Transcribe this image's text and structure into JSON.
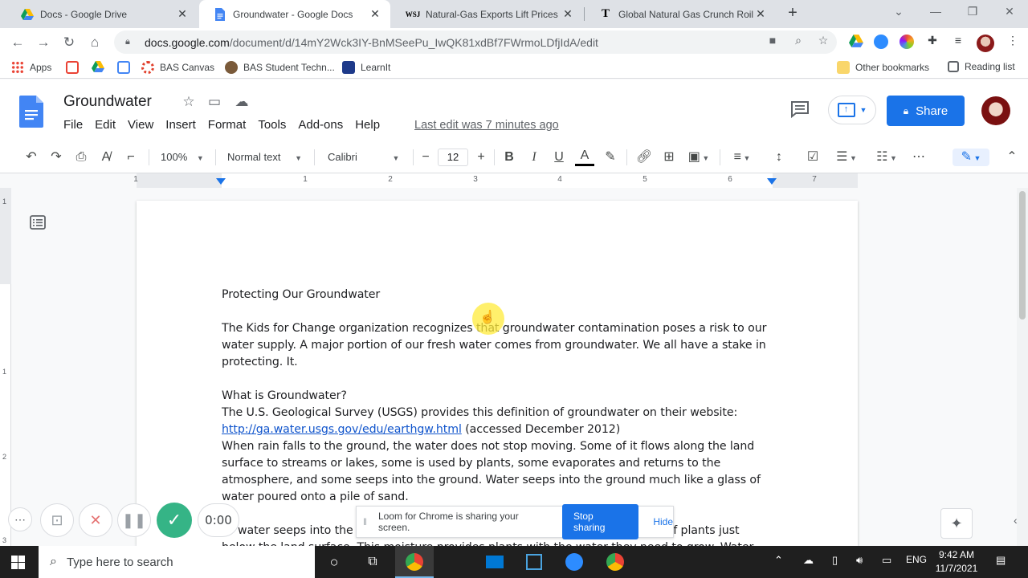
{
  "browser": {
    "tabs": [
      {
        "title": "Docs - Google Drive",
        "icon": "google-drive-icon"
      },
      {
        "title": "Groundwater - Google Docs",
        "icon": "google-docs-icon",
        "active": true
      },
      {
        "title": "Natural-Gas Exports Lift Prices fo",
        "icon": "wsj-icon"
      },
      {
        "title": "Global Natural Gas Crunch Roils (",
        "icon": "nyt-icon"
      }
    ],
    "url_host": "docs.google.com",
    "url_path": "/document/d/14mY2Wck3IY-BnMSeePu_IwQK81xdBf7FWrmoLDfjIdA/edit",
    "bookmarks": [
      {
        "label": "Apps",
        "icon": "apps-grid-icon"
      },
      {
        "label": "",
        "icon": "gmail-icon"
      },
      {
        "label": "",
        "icon": "google-drive-icon"
      },
      {
        "label": "",
        "icon": "calendar-icon"
      },
      {
        "label": "BAS Canvas",
        "icon": "canvas-icon"
      },
      {
        "label": "BAS Student Techn...",
        "icon": "student-icon"
      },
      {
        "label": "LearnIt",
        "icon": "learnit-icon"
      },
      {
        "label": "Other bookmarks",
        "icon": "folder-icon"
      },
      {
        "label": "Reading list",
        "icon": "reading-list-icon"
      }
    ]
  },
  "docs": {
    "title": "Groundwater",
    "menu": [
      "File",
      "Edit",
      "View",
      "Insert",
      "Format",
      "Tools",
      "Add-ons",
      "Help"
    ],
    "last_edit": "Last edit was 7 minutes ago",
    "share_label": "Share",
    "toolbar": {
      "zoom": "100%",
      "style": "Normal text",
      "font": "Calibri",
      "font_size": "12"
    },
    "ruler_numbers": [
      "1",
      "1",
      "2",
      "3",
      "4",
      "5",
      "6",
      "7"
    ],
    "vruler_numbers": [
      "1",
      "1",
      "2",
      "3"
    ]
  },
  "document": {
    "p1": "Protecting Our Groundwater",
    "p2": "The Kids for Change organization recognizes that groundwater contamination poses a risk to our water supply. A major portion of our fresh water comes from groundwater. We all have a stake in protecting. It.",
    "p3": "What is Groundwater?",
    "p4": "The U.S. Geological Survey (USGS) provides this definition of groundwater on their website:",
    "link": "http://ga.water.usgs.gov/edu/earthgw.html",
    "link_suffix": " (accessed December 2012)",
    "p5": "When rain falls to the ground, the water does not stop moving. Some of it flows along the land surface to streams or lakes, some is used by plants, some evaporates and returns to the atmosphere, and some seeps into the ground. Water seeps into the ground much like a glass of water poured onto a pile of sand.",
    "p6a": "water seeps into the",
    "p6b": "of plants just",
    "p7": "below the land surface. This moisture provides plants with the water they need to grow. Water"
  },
  "loom": {
    "timer": "0:00",
    "message": "Loom for Chrome is sharing your screen.",
    "stop_label": "Stop sharing",
    "hide_label": "Hide"
  },
  "taskbar": {
    "search_placeholder": "Type here to search",
    "lang": "ENG",
    "time": "9:42 AM",
    "date": "11/7/2021"
  },
  "colors": {
    "accent": "#1a73e8",
    "docs_blue": "#4285f4",
    "loom_green": "#35b486",
    "cursor_highlight": "#ffeb3b"
  }
}
